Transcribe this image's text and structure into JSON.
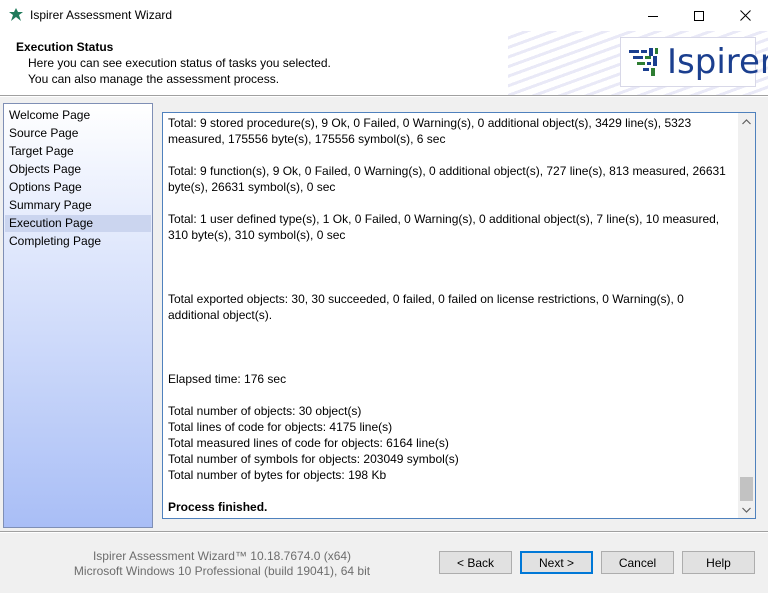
{
  "window": {
    "title": "Ispirer Assessment Wizard",
    "icon": "ispirer-leaf-icon"
  },
  "header": {
    "title": "Execution Status",
    "line1": "Here you can see execution status of tasks you selected.",
    "line2": "You can also manage the assessment process.",
    "logo_text": "Ispirer"
  },
  "nav": {
    "items": [
      {
        "label": "Welcome Page"
      },
      {
        "label": "Source Page"
      },
      {
        "label": "Target Page"
      },
      {
        "label": "Objects Page"
      },
      {
        "label": "Options Page"
      },
      {
        "label": "Summary Page"
      },
      {
        "label": "Execution Page",
        "active": true
      },
      {
        "label": "Completing Page"
      }
    ]
  },
  "log": {
    "procedures": "Total: 9 stored procedure(s), 9 Ok, 0 Failed, 0 Warning(s), 0 additional object(s), 3429 line(s), 5323 measured, 175556 byte(s), 175556 symbol(s), 6 sec",
    "functions": "Total: 9 function(s), 9 Ok, 0 Failed, 0 Warning(s), 0 additional object(s), 727 line(s), 813 measured, 26631 byte(s), 26631 symbol(s), 0 sec",
    "types": "Total: 1 user defined type(s), 1 Ok, 0 Failed, 0 Warning(s), 0 additional object(s), 7 line(s), 10 measured, 310 byte(s), 310 symbol(s), 0 sec",
    "exported": "Total exported objects: 30, 30 succeeded, 0 failed, 0 failed on license restrictions, 0 Warning(s), 0 additional object(s).",
    "elapsed": "Elapsed time: 176 sec",
    "total_objects": "Total number of objects: 30 object(s)",
    "total_lines": "Total lines of code for objects: 4175 line(s)",
    "total_measured": "Total measured lines of code for objects: 6164 line(s)",
    "total_symbols": "Total number of symbols for objects: 203049 symbol(s)",
    "total_bytes": "Total number of bytes for objects: 198 Kb",
    "finished": "Process finished."
  },
  "footer": {
    "version_line1": "Ispirer Assessment Wizard™ 10.18.7674.0 (x64)",
    "version_line2": "Microsoft Windows 10 Professional (build 19041), 64 bit",
    "back_label": "< Back",
    "next_label": "Next >",
    "cancel_label": "Cancel",
    "help_label": "Help"
  },
  "colors": {
    "accent_border": "#4f81bd",
    "logo_blue": "#1b3f8f",
    "logo_green": "#2e7d32",
    "default_button_border": "#0078d7"
  }
}
